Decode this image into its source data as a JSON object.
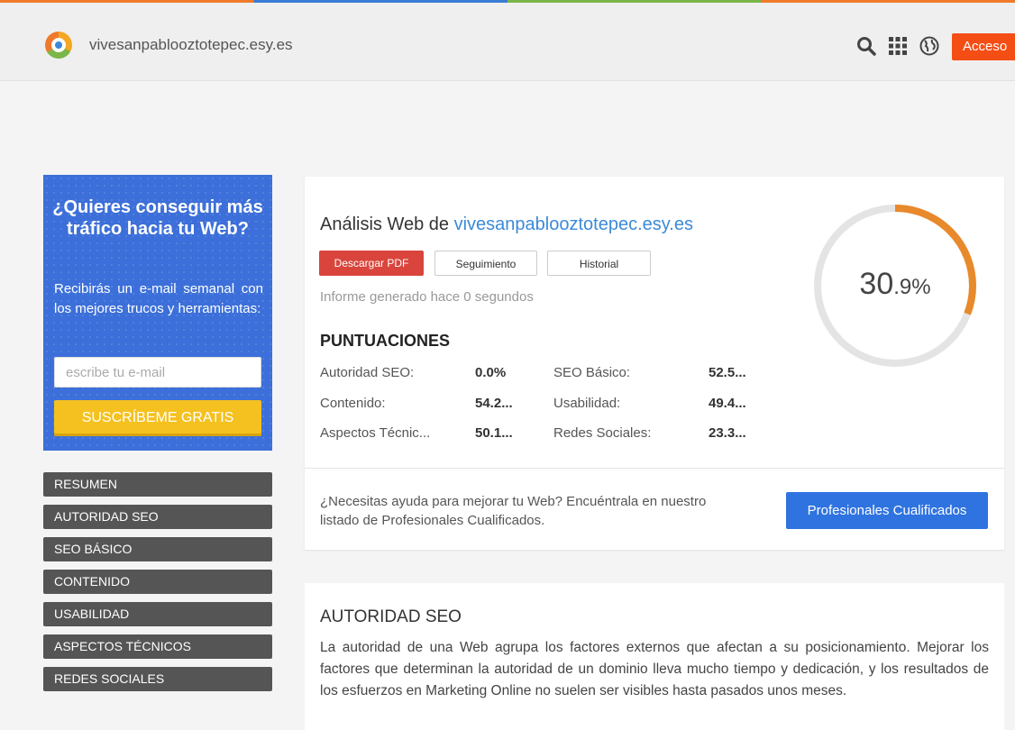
{
  "header": {
    "site_name": "vivesanpablooztotepec.esy.es",
    "access_label": "Acceso",
    "icons": [
      "search-icon",
      "grid-icon",
      "globe-icon"
    ]
  },
  "promo": {
    "title": "¿Quieres conseguir más tráfico hacia tu Web?",
    "text": "Recibirás un e-mail semanal con los mejores trucos y herramientas:",
    "email_placeholder": "escribe tu e-mail",
    "subscribe_label": "SUSCRÍBEME GRATIS"
  },
  "nav": {
    "items": [
      "RESUMEN",
      "AUTORIDAD SEO",
      "SEO BÁSICO",
      "CONTENIDO",
      "USABILIDAD",
      "ASPECTOS TÉCNICOS",
      "REDES SOCIALES"
    ]
  },
  "analysis": {
    "title_prefix": "Análisis Web de",
    "domain": "vivesanpablooztotepec.esy.es",
    "pdf_label": "Descargar PDF",
    "track_label": "Seguimiento",
    "history_label": "Historial",
    "report_time": "Informe generado hace 0 segundos",
    "scores_title": "PUNTUACIONES",
    "scores": [
      {
        "label": "Autoridad SEO:",
        "value": "0.0%"
      },
      {
        "label": "SEO Básico:",
        "value": "52.5..."
      },
      {
        "label": "Contenido:",
        "value": "54.2..."
      },
      {
        "label": "Usabilidad:",
        "value": "49.4..."
      },
      {
        "label": "Aspectos Técnic...",
        "value": "50.1..."
      },
      {
        "label": "Redes Sociales:",
        "value": "23.3..."
      }
    ],
    "overall_int": "30",
    "overall_dec": ".9%",
    "overall_fraction": 0.309,
    "help_text": "¿Necesitas ayuda para mejorar tu Web? Encuéntrala en nuestro listado de Profesionales Cualificados.",
    "pro_label": "Profesionales Cualificados"
  },
  "authority": {
    "title": "AUTORIDAD SEO",
    "text": "La autoridad de una Web agrupa los factores externos que afectan a su posicionamiento. Mejorar los factores que determinan la autoridad de un dominio lleva mucho tiempo y dedicación, y los resultados de los esfuerzos en Marketing Online no suelen ser visibles hasta pasados unos meses."
  },
  "colors": {
    "accent": "#f44e15",
    "promo_bg": "#3c6fd9",
    "gauge": "#e8892b",
    "link": "#3b8ad8"
  }
}
